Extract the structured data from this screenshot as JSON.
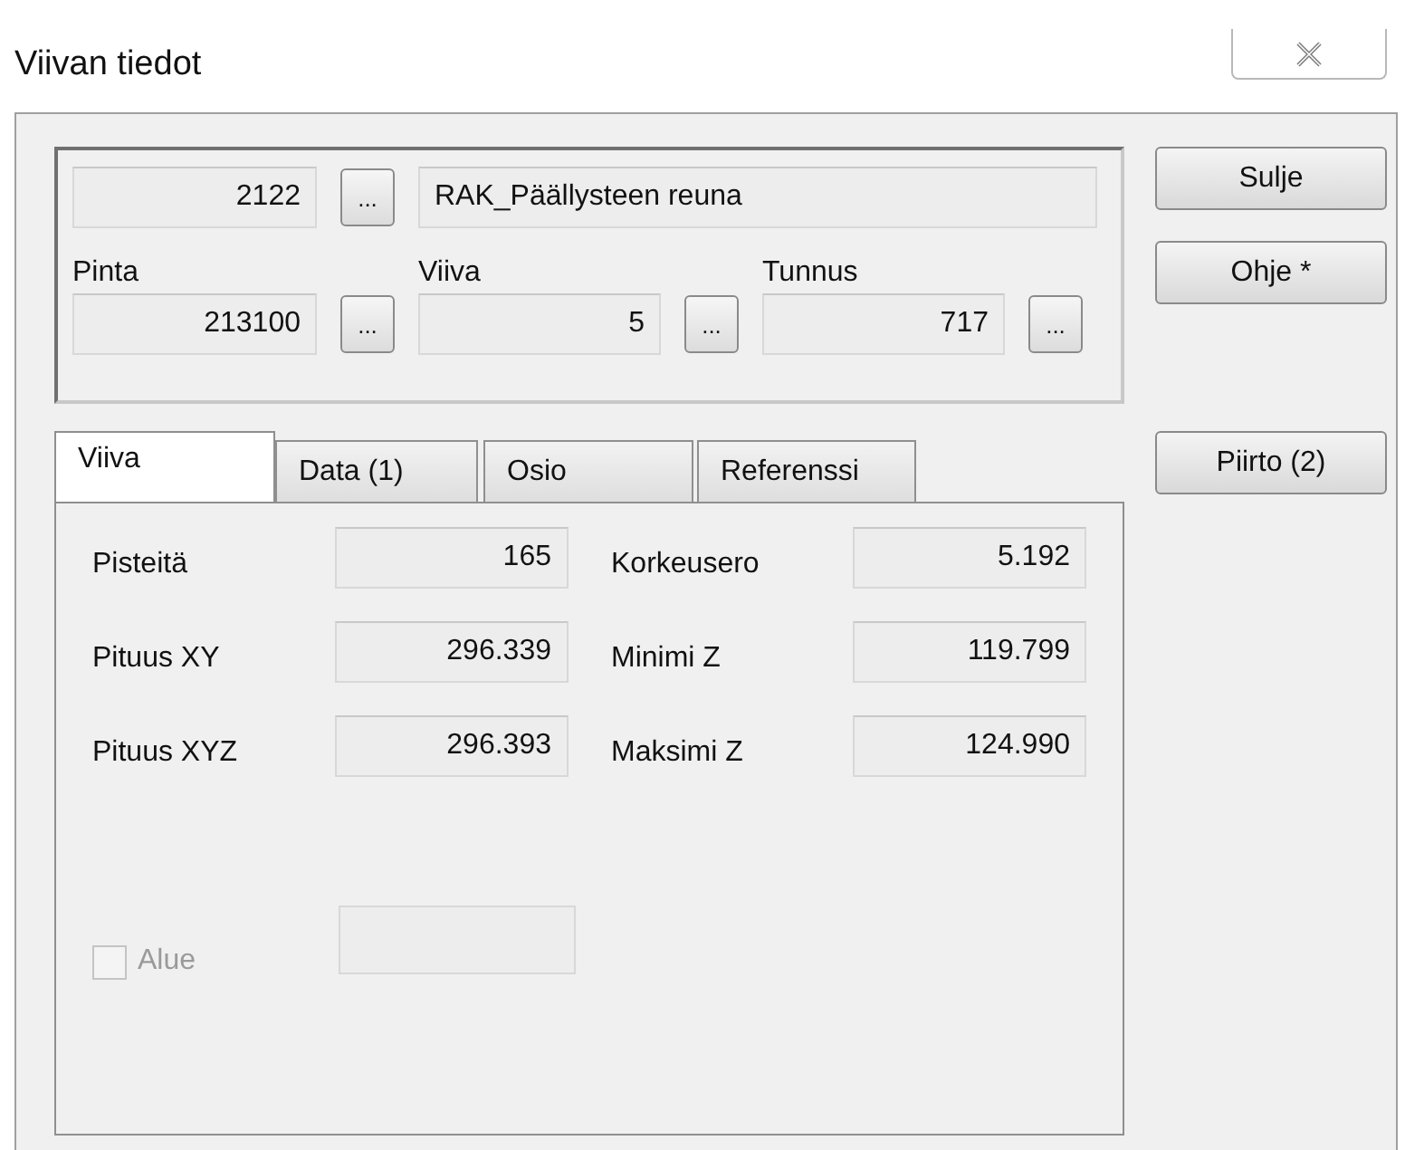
{
  "window": {
    "title": "Viivan tiedot"
  },
  "code": {
    "value": "2122",
    "name": "RAK_Päällysteen reuna"
  },
  "fields": [
    {
      "label": "Pinta",
      "value": "213100"
    },
    {
      "label": "Viiva",
      "value": "5"
    },
    {
      "label": "Tunnus",
      "value": "717"
    }
  ],
  "ellipsis": "...",
  "buttons": [
    {
      "label": "Sulje"
    },
    {
      "label": "Ohje *"
    },
    {
      "label": "Piirto (2)"
    }
  ],
  "tabs": [
    {
      "label": "Viiva",
      "selected": true
    },
    {
      "label": "Data (1)",
      "selected": false
    },
    {
      "label": "Osio",
      "selected": false
    },
    {
      "label": "Referenssi",
      "selected": false
    }
  ],
  "stats": [
    {
      "label": "Pisteitä",
      "value": "165",
      "label_2": "Korkeusero",
      "value_2": "5.192"
    },
    {
      "label": "Pituus XY",
      "value": "296.339",
      "label_2": "Minimi Z",
      "value_2": "119.799"
    },
    {
      "label": "Pituus XYZ",
      "value": "296.393",
      "label_2": "Maksimi Z",
      "value_2": "124.990"
    }
  ],
  "area": {
    "label": "Alue",
    "checked": false,
    "disabled": true
  }
}
